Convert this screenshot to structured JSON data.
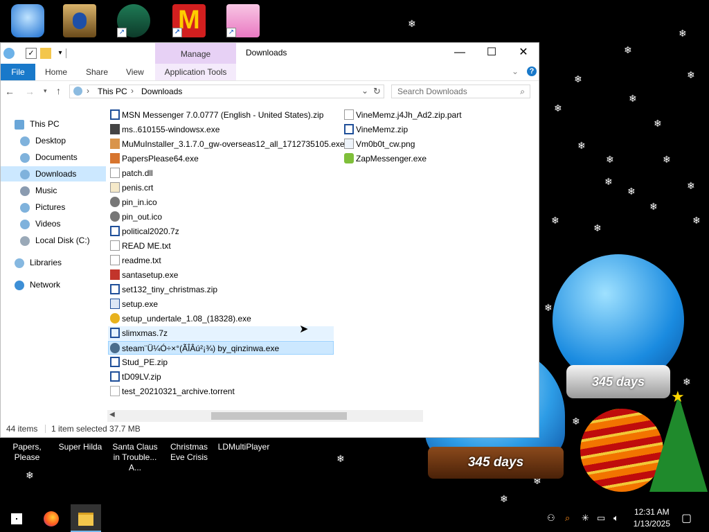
{
  "desktop": {
    "top_icons": [
      {
        "label": "",
        "icon": "imac-icon"
      },
      {
        "label": "",
        "icon": "winamp-player-icon"
      },
      {
        "label": "",
        "icon": "anime-game-shortcut-icon"
      },
      {
        "label": "",
        "icon": "mcdonalds-shortcut-icon"
      },
      {
        "label": "",
        "icon": "pig-game-shortcut-icon"
      }
    ],
    "bottom_icons": [
      {
        "label": "Papers, Please",
        "icon": "papers-please-icon"
      },
      {
        "label": "Super Hilda",
        "icon": "super-hilda-icon"
      },
      {
        "label": "Santa Claus in Trouble... A...",
        "icon": "santa-claus-icon"
      },
      {
        "label": "Christmas Eve Crisis",
        "icon": "christmas-eve-icon"
      },
      {
        "label": "LDMultiPlayer",
        "icon": "ldmultiplayer-icon"
      }
    ],
    "globe_counter_1": "345 days",
    "globe_counter_2": "345 days"
  },
  "window": {
    "title": "Downloads",
    "manage_tab": "Manage",
    "ribbon": {
      "file": "File",
      "home": "Home",
      "share": "Share",
      "view": "View",
      "application_tools": "Application Tools"
    },
    "address": {
      "segments": [
        "This PC",
        "Downloads"
      ],
      "separator": "›",
      "search_placeholder": "Search Downloads"
    },
    "nav": {
      "this_pc": "This PC",
      "desktop": "Desktop",
      "documents": "Documents",
      "downloads": "Downloads",
      "music": "Music",
      "pictures": "Pictures",
      "videos": "Videos",
      "local_disk": "Local Disk (C:)",
      "libraries": "Libraries",
      "network": "Network"
    },
    "files_col1": [
      {
        "name": "MSN Messenger 7.0.0777 (English - United States).zip",
        "icon": "zip-icon"
      },
      {
        "name": "ms..610155-windowsx.exe",
        "icon": "installer-icon"
      },
      {
        "name": "MuMuInstaller_3.1.7.0_gw-overseas12_all_1712735105.exe",
        "icon": "package-icon"
      },
      {
        "name": "PapersPlease64.exe",
        "icon": "exe-icon"
      },
      {
        "name": "patch.dll",
        "icon": "dll-icon"
      },
      {
        "name": "penis.crt",
        "icon": "certificate-icon"
      },
      {
        "name": "pin_in.ico",
        "icon": "ico-file-icon"
      },
      {
        "name": "pin_out.ico",
        "icon": "ico-file-icon"
      },
      {
        "name": "political2020.7z",
        "icon": "zip-icon"
      },
      {
        "name": "READ ME.txt",
        "icon": "text-file-icon"
      },
      {
        "name": "readme.txt",
        "icon": "text-file-icon"
      },
      {
        "name": "santasetup.exe",
        "icon": "santa-exe-icon"
      },
      {
        "name": "set132_tiny_christmas.zip",
        "icon": "zip-icon"
      },
      {
        "name": "setup.exe",
        "icon": "setup-icon"
      },
      {
        "name": "setup_undertale_1.08_(18328).exe",
        "icon": "disc-icon"
      },
      {
        "name": "slimxmas.7z",
        "icon": "zip-icon"
      },
      {
        "name": "steam¨Ü¼Ó÷×°(ÃÎÂú²¡¾) by_qinzinwa.exe",
        "icon": "steam-exe-icon"
      },
      {
        "name": "Stud_PE.zip",
        "icon": "zip-icon"
      },
      {
        "name": "tD09LV.zip",
        "icon": "zip-icon"
      },
      {
        "name": "test_20210321_archive.torrent",
        "icon": "torrent-file-icon"
      }
    ],
    "files_col2": [
      {
        "name": "VineMemz.j4Jh_Ad2.zip.part",
        "icon": "part-file-icon"
      },
      {
        "name": "VineMemz.zip",
        "icon": "zip-icon"
      },
      {
        "name": "Vm0b0t_cw.png",
        "icon": "image-file-icon"
      },
      {
        "name": "ZapMessenger.exe",
        "icon": "zap-exe-icon"
      }
    ],
    "status": {
      "item_count": "44 items",
      "selection": "1 item selected  37.7 MB"
    }
  },
  "taskbar": {
    "time": "12:31 AM",
    "date": "1/13/2025"
  },
  "colors": {
    "file_tab": "#1979ca",
    "manage_tab": "#e7d1f5",
    "selection": "#cce8ff",
    "desktop_bg": "#000000"
  }
}
